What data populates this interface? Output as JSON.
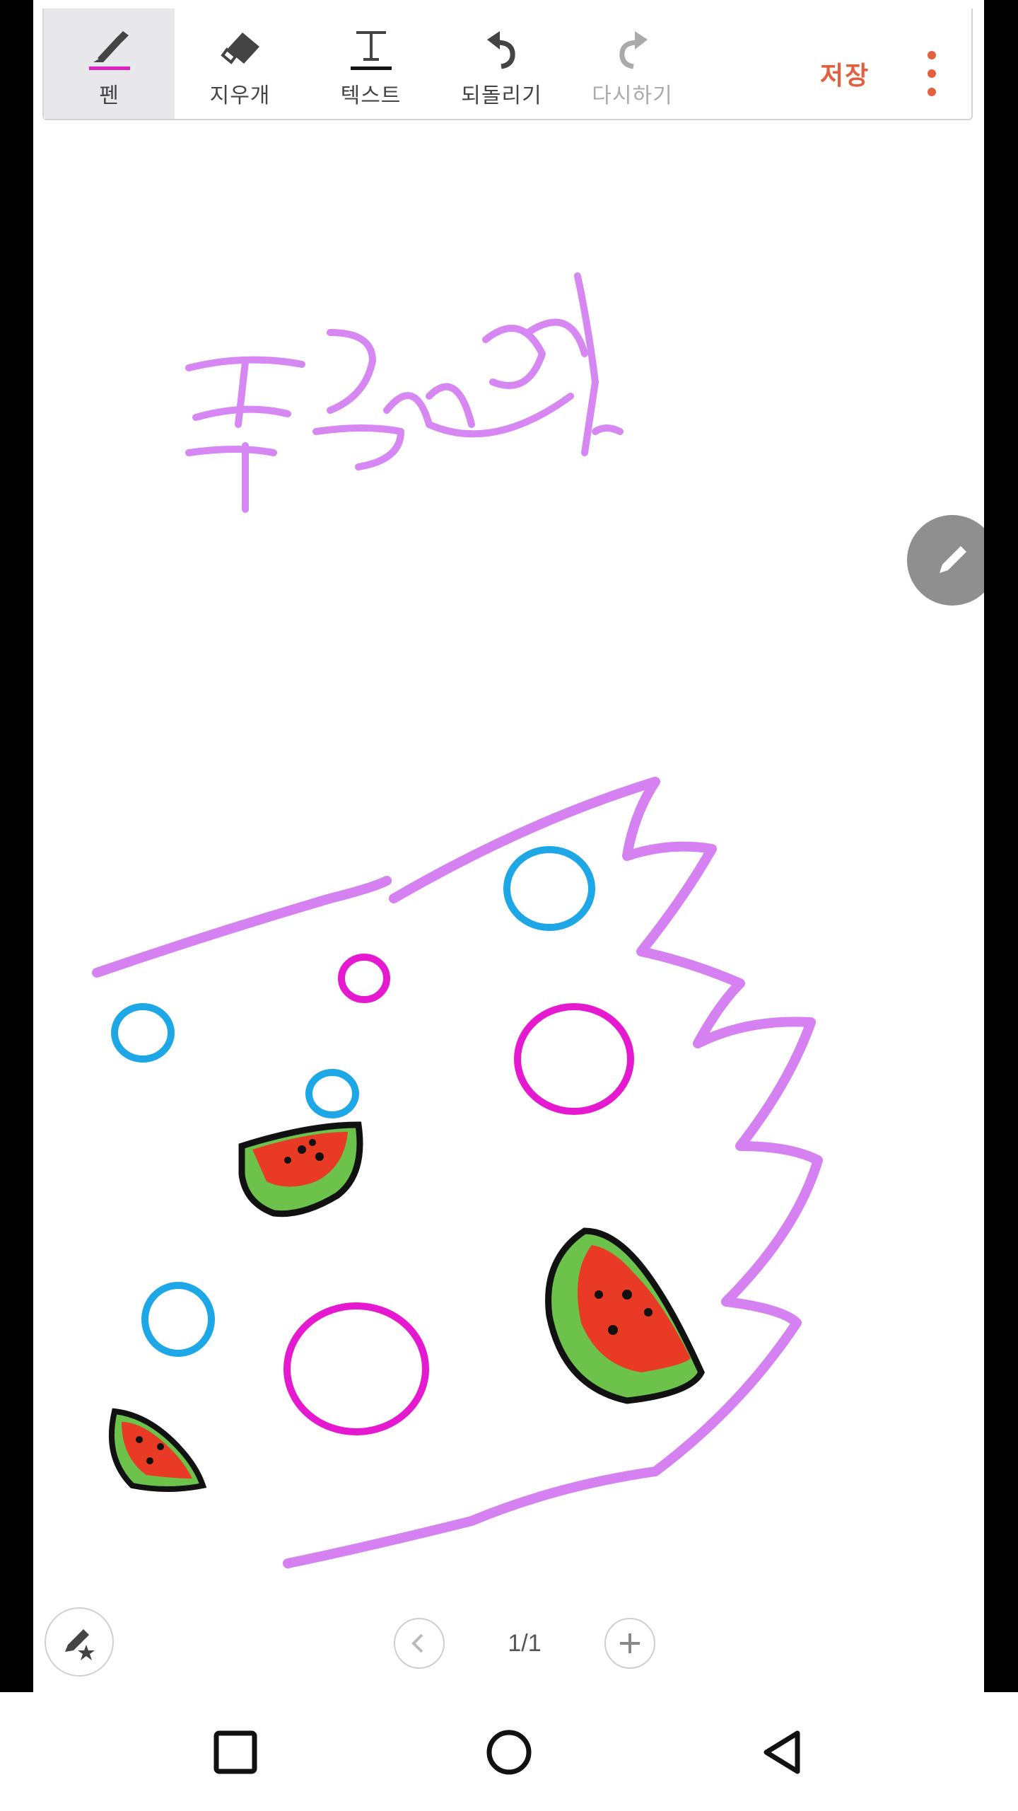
{
  "toolbar": {
    "pen_label": "펜",
    "eraser_label": "지우개",
    "text_label": "텍스트",
    "undo_label": "되돌리기",
    "redo_label": "다시하기",
    "save_label": "저장",
    "pen_color": "#e020c0"
  },
  "canvas": {
    "handwriting_text": "클라우드",
    "stroke_colors": [
      "#d581f2",
      "#1ea7e6",
      "#e51ad0",
      "#e83a25",
      "#6cc24a",
      "#111111"
    ]
  },
  "pager": {
    "page_indicator": "1/1"
  },
  "icons": {
    "edit": "pencil-icon",
    "favorite_pen": "pen-star-icon",
    "prev": "chevron-left-icon",
    "add_page": "plus-icon",
    "nav_recents": "square-icon",
    "nav_home": "circle-icon",
    "nav_back": "triangle-back-icon"
  },
  "colors": {
    "accent": "#e2603f",
    "fab": "#8f8f8f"
  }
}
